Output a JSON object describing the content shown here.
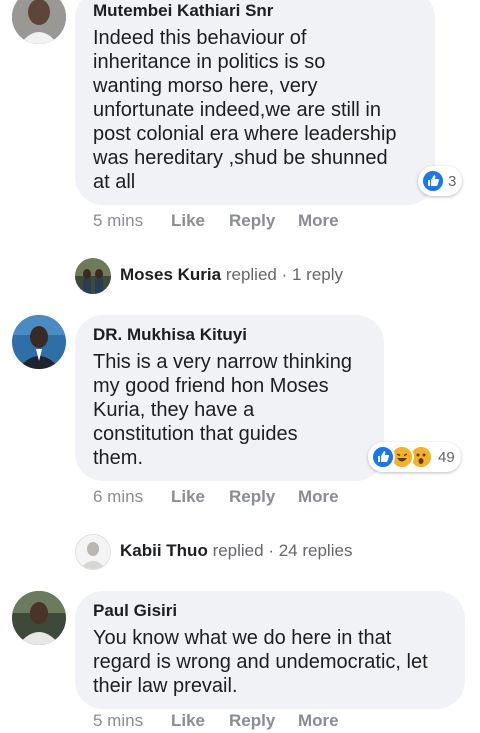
{
  "comments": [
    {
      "author": "Mutembei Kathiari Snr",
      "lines": [
        "Indeed this behaviour of",
        "inheritance in politics is so",
        "wanting morso here, very",
        "unfortunate indeed,we are still in",
        "post colonial era where leadership",
        "was hereditary ,shud be shunned",
        "at all"
      ],
      "time": "5 mins",
      "reaction_count": "3",
      "reactions": [
        "like-icon"
      ]
    },
    {
      "author": "DR. Mukhisa Kituyi",
      "lines": [
        "This is a very narrow thinking",
        "my good friend hon Moses",
        "Kuria, they have a",
        "constitution that guides",
        "them."
      ],
      "time": "6 mins",
      "reaction_count": "49",
      "reactions": [
        "like-icon",
        "haha-icon",
        "wow-icon"
      ]
    },
    {
      "author": "Paul Gisiri",
      "lines": [
        "You know what we do here in that",
        "regard is wrong and undemocratic, let",
        "their law prevail."
      ],
      "time": "5 mins"
    }
  ],
  "replies_summary": [
    {
      "name": "Moses Kuria",
      "verb": "replied",
      "count": "· 1 reply"
    },
    {
      "name": "Kabii Thuo",
      "verb": "replied",
      "count": "· 24 replies"
    }
  ],
  "actions": {
    "like": "Like",
    "reply": "Reply",
    "more": "More"
  },
  "colors": {
    "bubble": "#f0f2f5",
    "like_blue": "#1877f2",
    "haha_yellow": "#f7b125",
    "meta_gray": "#8a8d91"
  }
}
